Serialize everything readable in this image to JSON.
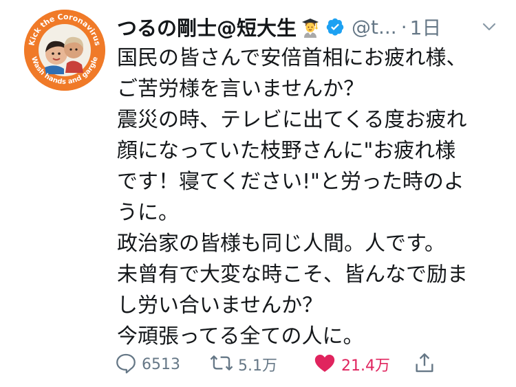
{
  "avatar": {
    "ring_text_top": "Kick the Coronavirus",
    "ring_text_bottom": "Wash hands and gargle",
    "ring_color": "#f07a28"
  },
  "tweet": {
    "display_name": "つるの剛士@短大生",
    "name_emoji": "student-graduate-emoji",
    "handle": "@t...",
    "separator": "·",
    "time": "1日",
    "body": "国民の皆さんで安倍首相にお疲れ様、\nご苦労様を言いませんか？\n震災の時、テレビに出てくる度お疲れ\n顔になっていた枝野さんに\"お疲れ様\nです！寝てください!\"と労った時のよ\nうに。\n政治家の皆様も同じ人間。人です。\n未曾有で大変な時こそ、皆んなで励ま\nし労い合いませんか？\n今頑張ってる全ての人に。"
  },
  "actions": {
    "reply_count": "6513",
    "retweet_count": "5.1万",
    "like_count": "21.4万",
    "icons": [
      "reply-icon",
      "retweet-icon",
      "heart-icon",
      "share-icon"
    ]
  },
  "colors": {
    "text": "#14171a",
    "secondary": "#657786",
    "like": "#e0245e",
    "verified": "#1da1f2"
  }
}
